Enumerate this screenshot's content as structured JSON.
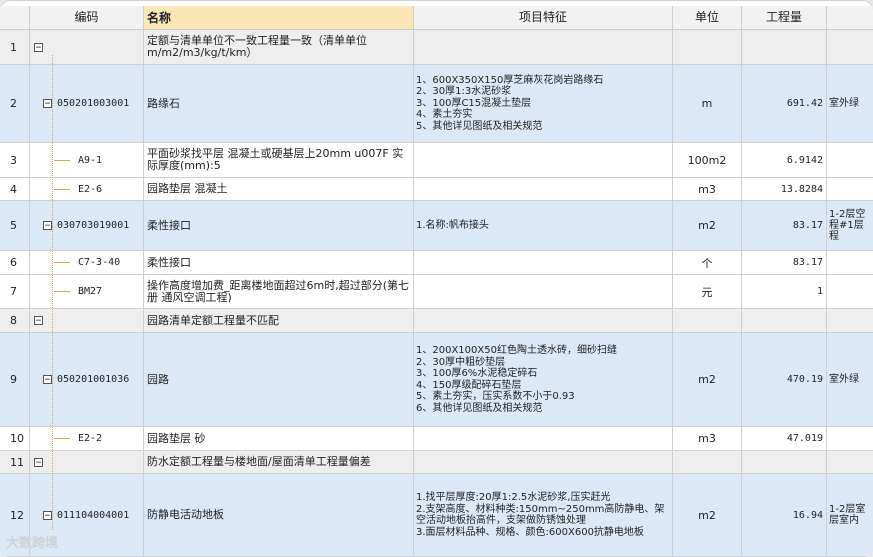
{
  "headers": {
    "code": "编码",
    "name": "名称",
    "feature": "项目特征",
    "unit": "单位",
    "qty": "工程量"
  },
  "rows": [
    {
      "no": "1",
      "code": "",
      "name": "定额与清单单位不一致工程量一致（清单单位m/m2/m3/kg/t/km）",
      "feature": "",
      "unit": "",
      "qty": "",
      "remark": ""
    },
    {
      "no": "2",
      "code": "050201003001",
      "name": "路缘石",
      "feature": "1、600X350X150厚芝麻灰花岗岩路缘石\n2、30厚1:3水泥砂浆\n3、100厚C15混凝土垫层\n4、素土夯实\n5、其他详见图纸及相关规范",
      "unit": "m",
      "qty": "691.42",
      "remark": "室外绿"
    },
    {
      "no": "3",
      "code": "A9-1",
      "name": "平面砂浆找平层 混凝土或硬基层上20mm u007F 实际厚度(mm):5",
      "feature": "",
      "unit": "100m2",
      "qty": "6.9142",
      "remark": ""
    },
    {
      "no": "4",
      "code": "E2-6",
      "name": "园路垫层 混凝土",
      "feature": "",
      "unit": "m3",
      "qty": "13.8284",
      "remark": ""
    },
    {
      "no": "5",
      "code": "030703019001",
      "name": "柔性接口",
      "feature": "1.名称:帆布接头",
      "unit": "m2",
      "qty": "83.17",
      "remark": "1-2层空\n程#1层\n程"
    },
    {
      "no": "6",
      "code": "C7-3-40",
      "name": "柔性接口",
      "feature": "",
      "unit": "个",
      "qty": "83.17",
      "remark": ""
    },
    {
      "no": "7",
      "code": "BM27",
      "name": "操作高度增加费_距离楼地面超过6m时,超过部分(第七册 通风空调工程)",
      "feature": "",
      "unit": "元",
      "qty": "1",
      "remark": ""
    },
    {
      "no": "8",
      "code": "",
      "name": "园路清单定额工程量不匹配",
      "feature": "",
      "unit": "",
      "qty": "",
      "remark": ""
    },
    {
      "no": "9",
      "code": "050201001036",
      "name": "园路",
      "feature": "1、200X100X50红色陶土透水砖，细砂扫缝\n2、30厚中粗砂垫层\n3、100厚6%水泥稳定碎石\n4、150厚级配碎石垫层\n5、素土夯实，压实系数不小于0.93\n6、其他详见图纸及相关规范",
      "unit": "m2",
      "qty": "470.19",
      "remark": "室外绿"
    },
    {
      "no": "10",
      "code": "E2-2",
      "name": "园路垫层 砂",
      "feature": "",
      "unit": "m3",
      "qty": "47.019",
      "remark": ""
    },
    {
      "no": "11",
      "code": "",
      "name": "防水定额工程量与楼地面/屋面清单工程量偏差",
      "feature": "",
      "unit": "",
      "qty": "",
      "remark": ""
    },
    {
      "no": "12",
      "code": "011104004001",
      "name": "防静电活动地板",
      "feature": "1.找平层厚度:20厚1:2.5水泥砂浆,压实赶光\n2.支架高度、材料种类:150mm~250mm高防静电、架空活动地板抬高件，支架做防锈蚀处理\n3.面层材料品种、规格、颜色:600X600抗静电地板",
      "unit": "m2",
      "qty": "16.94",
      "remark": "1-2层室\n层室内"
    }
  ],
  "watermark": "大数跨境",
  "icons": {
    "collapse": "minus-box-icon"
  }
}
